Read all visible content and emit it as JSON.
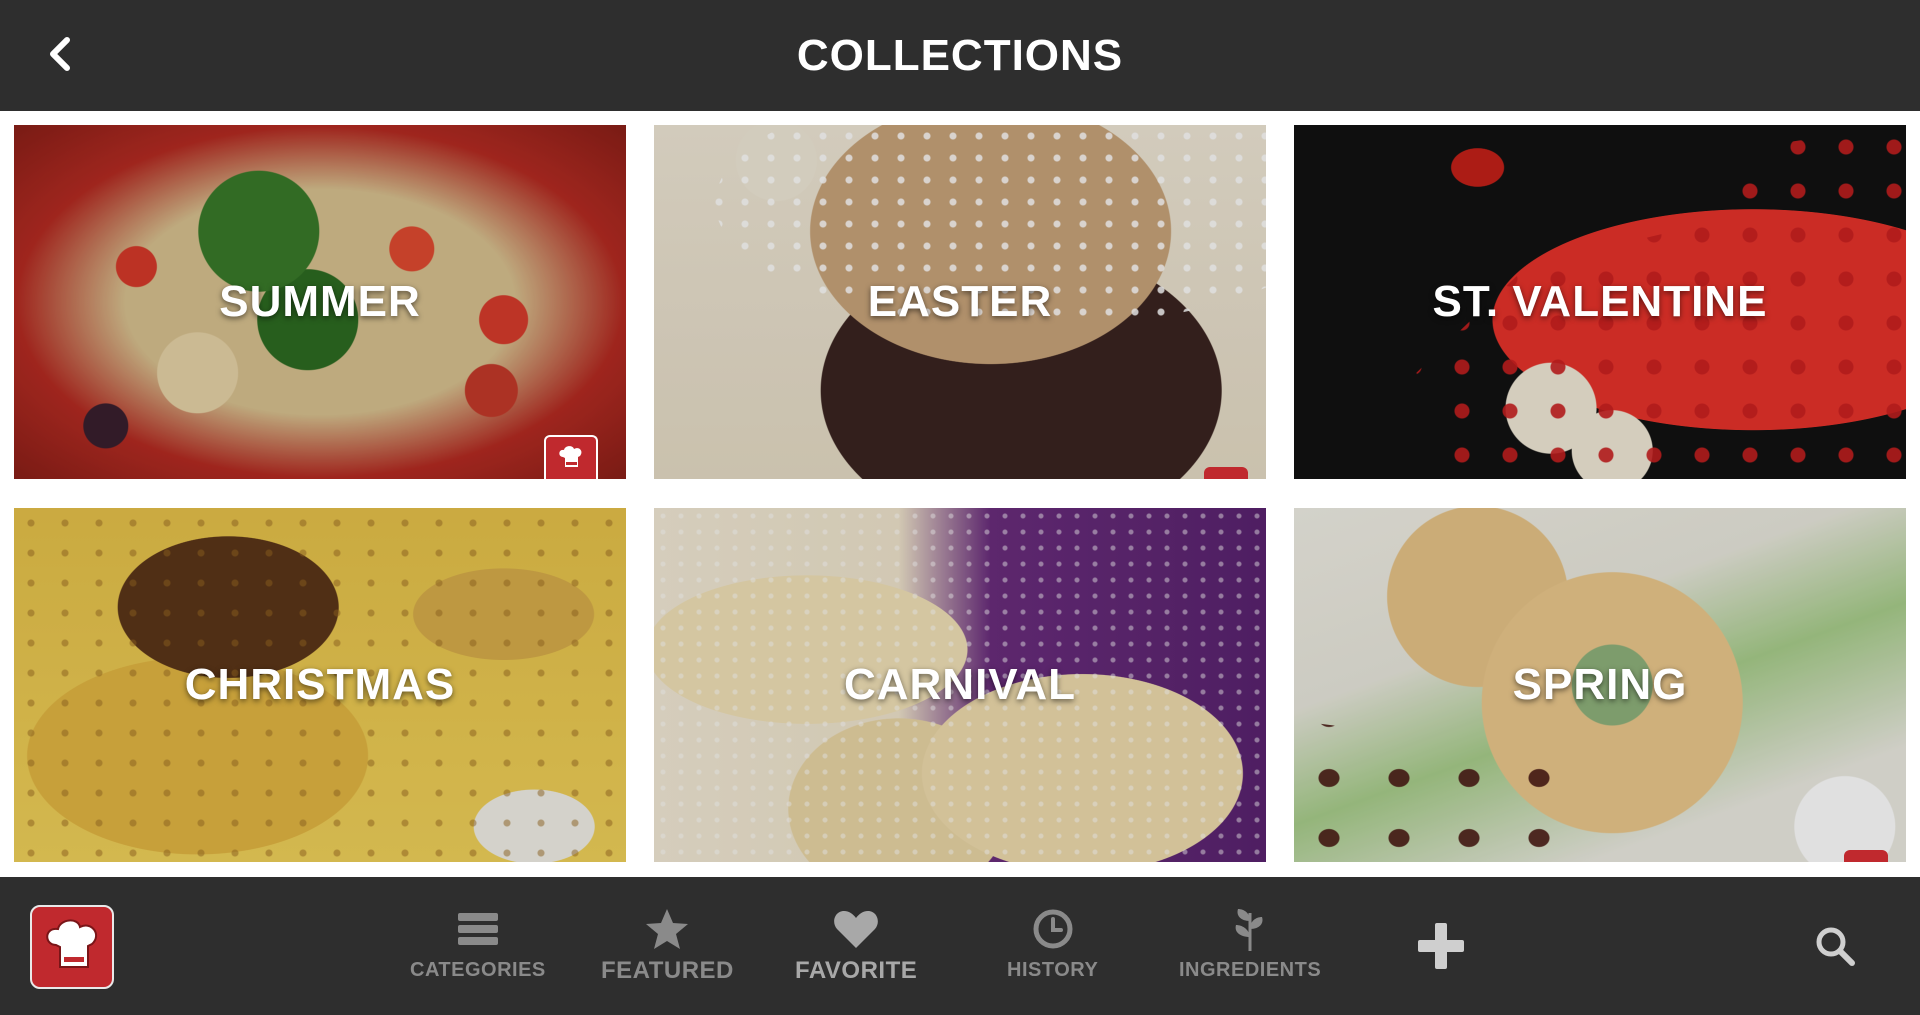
{
  "header": {
    "title": "COLLECTIONS",
    "back_icon": "chevron-left-icon"
  },
  "collections": [
    {
      "label": "SUMMER"
    },
    {
      "label": "EASTER"
    },
    {
      "label": "ST. VALENTINE"
    },
    {
      "label": "CHRISTMAS"
    },
    {
      "label": "CARNIVAL"
    },
    {
      "label": "SPRING"
    }
  ],
  "bottom_nav": {
    "logo_icon": "chef-hat-icon",
    "items": [
      {
        "label": "CATEGORIES",
        "icon": "list-icon"
      },
      {
        "label": "FEATURED",
        "icon": "star-icon"
      },
      {
        "label": "FAVORITE",
        "icon": "heart-icon"
      },
      {
        "label": "HISTORY",
        "icon": "clock-icon"
      },
      {
        "label": "INGREDIENTS",
        "icon": "leaf-icon"
      }
    ],
    "add_icon": "plus-icon",
    "search_icon": "search-icon"
  },
  "colors": {
    "bar_bg": "#2e2e2e",
    "accent_red": "#c0292e",
    "nav_text": "#8a8a8a"
  }
}
